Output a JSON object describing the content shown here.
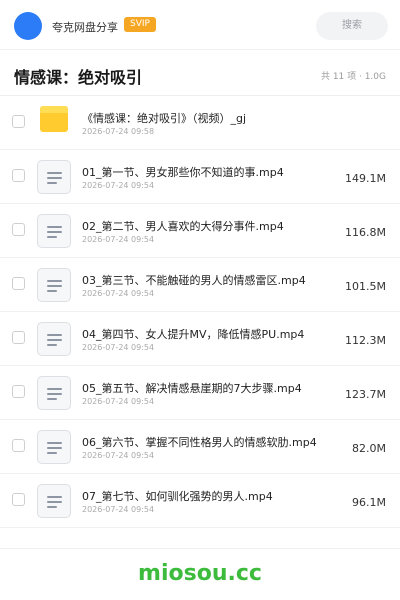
{
  "header": {
    "owner": "夸克网盘分享",
    "badge": "SVIP",
    "search_placeholder": "搜索"
  },
  "folder": {
    "title": "情感课：绝对吸引",
    "meta": "共 11 项 · 1.0G"
  },
  "items": [
    {
      "type": "folder",
      "name": "《情感课：绝对吸引》（视频）_gj",
      "date": "2026-07-24 09:58",
      "size": ""
    },
    {
      "type": "file",
      "name": "01_第一节、男女那些你不知道的事.mp4",
      "date": "2026-07-24 09:54",
      "size": "149.1M"
    },
    {
      "type": "file",
      "name": "02_第二节、男人喜欢的大得分事件.mp4",
      "date": "2026-07-24 09:54",
      "size": "116.8M"
    },
    {
      "type": "file",
      "name": "03_第三节、不能触碰的男人的情感雷区.mp4",
      "date": "2026-07-24 09:54",
      "size": "101.5M"
    },
    {
      "type": "file",
      "name": "04_第四节、女人提升MV，降低情感PU.mp4",
      "date": "2026-07-24 09:54",
      "size": "112.3M"
    },
    {
      "type": "file",
      "name": "05_第五节、解决情感悬崖期的7大步骤.mp4",
      "date": "2026-07-24 09:54",
      "size": "123.7M"
    },
    {
      "type": "file",
      "name": "06_第六节、掌握不同性格男人的情感软肋.mp4",
      "date": "2026-07-24 09:54",
      "size": "82.0M"
    },
    {
      "type": "file",
      "name": "07_第七节、如何驯化强势的男人.mp4",
      "date": "2026-07-24 09:54",
      "size": "96.1M"
    }
  ],
  "watermark": "miosou.cc",
  "colors": {
    "accent": "#2b7cf6",
    "badge": "#f5a623",
    "folder": "#ffcb2f",
    "watermark": "#3dbb3d"
  }
}
